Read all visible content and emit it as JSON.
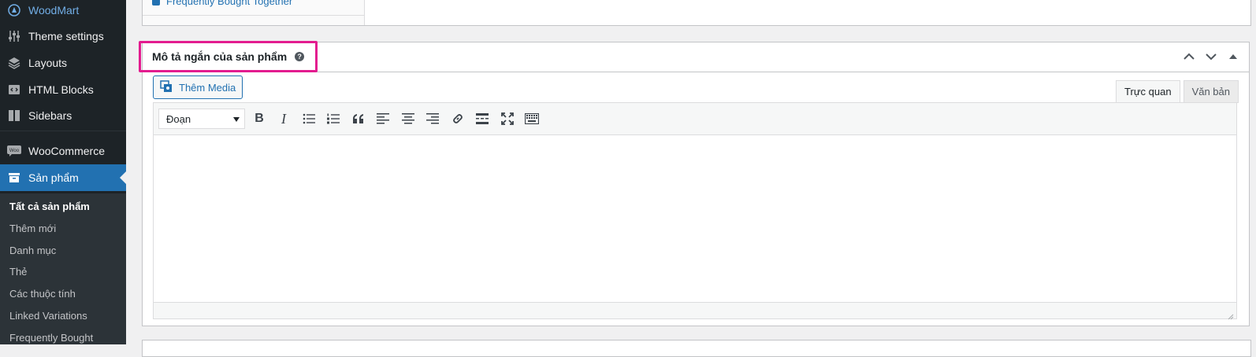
{
  "sidebar": {
    "items": [
      {
        "label": "WoodMart",
        "icon": "woodmart-icon"
      },
      {
        "label": "Theme settings",
        "icon": "sliders-icon"
      },
      {
        "label": "Layouts",
        "icon": "layers-icon"
      },
      {
        "label": "HTML Blocks",
        "icon": "code-block-icon"
      },
      {
        "label": "Sidebars",
        "icon": "sidebar-icon"
      },
      {
        "label": "WooCommerce",
        "icon": "woo-icon"
      },
      {
        "label": "Sản phẩm",
        "icon": "archive-icon"
      }
    ],
    "submenu": [
      {
        "label": "Tất cả sản phẩm",
        "current": true
      },
      {
        "label": "Thêm mới"
      },
      {
        "label": "Danh mục"
      },
      {
        "label": "Thẻ"
      },
      {
        "label": "Các thuộc tính"
      },
      {
        "label": "Linked Variations"
      },
      {
        "label": "Frequently Bought"
      }
    ]
  },
  "top_panel": {
    "link_label": "Frequently Bought Together"
  },
  "postbox": {
    "title": "Mô tả ngắn của sản phẩm",
    "help_icon": "question-icon"
  },
  "editor": {
    "add_media_label": "Thêm Media",
    "tabs": [
      "Trực quan",
      "Văn bản"
    ],
    "format_value": "Đoạn",
    "toolbar_buttons": [
      "bold-icon",
      "italic-icon",
      "bullet-list-icon",
      "numbered-list-icon",
      "blockquote-icon",
      "align-left-icon",
      "align-center-icon",
      "align-right-icon",
      "link-icon",
      "read-more-icon",
      "fullscreen-icon",
      "toolbar-toggle-icon"
    ]
  },
  "colors": {
    "sidebar_bg": "#1d2327",
    "active_bg": "#2271b1",
    "highlight": "#e31c8f"
  }
}
